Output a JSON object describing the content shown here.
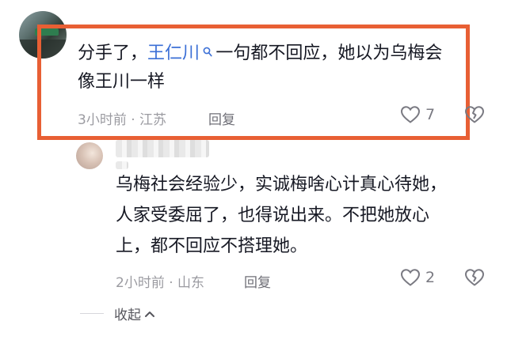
{
  "comment1": {
    "text_before": "分手了，",
    "mention": "王仁川",
    "text_after": "一句都不回应，她以为乌梅会",
    "line2": "像王川一样",
    "time_location": "3小时前 · 江苏",
    "reply_label": "回复",
    "like_count": "7"
  },
  "comment2": {
    "line1": "乌梅社会经验少，实诚梅啥心计真心待她，",
    "line2": "人家受委屈了，也得说出来。不把她放心",
    "line3": "上，都不回应不搭理她。",
    "time_location": "2小时前 · 山东",
    "reply_label": "回复",
    "like_count": "2"
  },
  "collapse_label": "收起",
  "colors": {
    "highlight_border": "#e85f34",
    "mention": "#3b6fd6"
  },
  "icons": [
    "search-icon",
    "heart-outline-icon",
    "broken-heart-icon",
    "chevron-up-icon"
  ]
}
